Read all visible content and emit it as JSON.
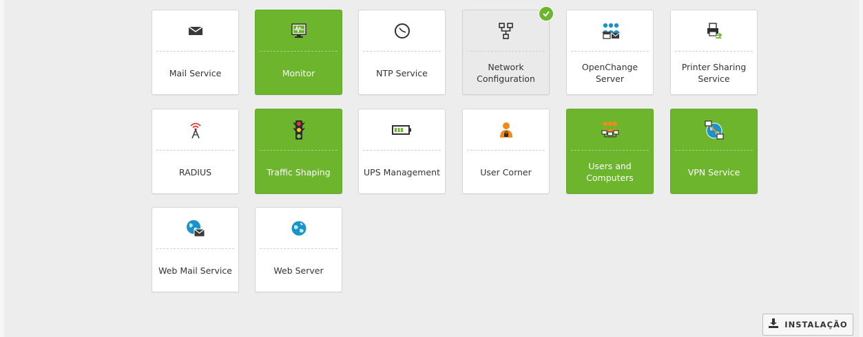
{
  "tiles": [
    {
      "label": "Mail Service",
      "icon": "mail-icon",
      "state": "normal"
    },
    {
      "label": "Monitor",
      "icon": "monitor-icon",
      "state": "enabled"
    },
    {
      "label": "NTP Service",
      "icon": "clock-icon",
      "state": "normal"
    },
    {
      "label": "Network Configuration",
      "icon": "network-icon",
      "state": "installed"
    },
    {
      "label": "OpenChange Server",
      "icon": "groupware-icon",
      "state": "normal"
    },
    {
      "label": "Printer Sharing Service",
      "icon": "printer-icon",
      "state": "normal"
    },
    {
      "label": "RADIUS",
      "icon": "antenna-icon",
      "state": "normal"
    },
    {
      "label": "Traffic Shaping",
      "icon": "traffic-light-icon",
      "state": "enabled"
    },
    {
      "label": "UPS Management",
      "icon": "battery-icon",
      "state": "normal"
    },
    {
      "label": "User Corner",
      "icon": "user-icon",
      "state": "normal"
    },
    {
      "label": "Users and Computers",
      "icon": "users-computers-icon",
      "state": "enabled"
    },
    {
      "label": "VPN Service",
      "icon": "vpn-icon",
      "state": "enabled"
    },
    {
      "label": "Web Mail Service",
      "icon": "webmail-icon",
      "state": "normal"
    },
    {
      "label": "Web Server",
      "icon": "globe-icon",
      "state": "normal"
    }
  ],
  "install_button": {
    "label": "INSTALAÇÃO",
    "icon": "install-icon"
  },
  "colors": {
    "enabled": "#6cb52d",
    "normal": "#ffffff",
    "installed": "#eaeaea",
    "background": "#ededed"
  }
}
